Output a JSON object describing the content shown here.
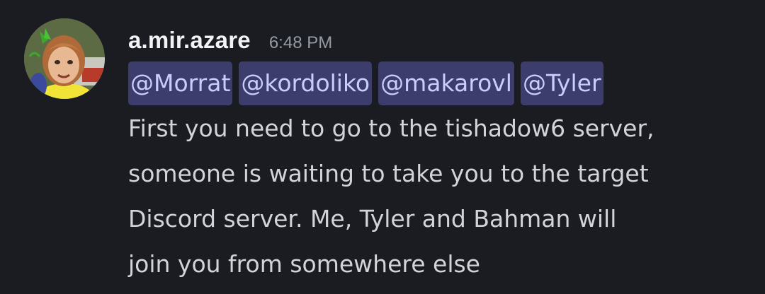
{
  "message": {
    "author": "a.mir.azare",
    "timestamp": "6:48 PM",
    "avatar_icon": "avatar-icon",
    "mentions": [
      "@Morrat",
      "@kordoliko",
      "@makarovl",
      "@Tyler"
    ],
    "lines": [
      "First you need to go to the tishadow6 server,",
      "someone is waiting to take you to the target",
      "Discord server. Me, Tyler and Bahman will",
      "join you from somewhere else"
    ]
  },
  "colors": {
    "background": "#1b1b22",
    "username": "#f2f3f5",
    "timestamp": "#949ba4",
    "text": "#d2d4d8",
    "mention_bg": "#3c3d6c",
    "mention_text": "#c9cdfb"
  }
}
